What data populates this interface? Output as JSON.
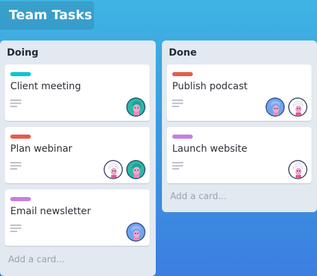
{
  "board": {
    "title": "Team Tasks"
  },
  "lists": [
    {
      "title": "Doing",
      "add_card": "Add a card...",
      "cards": [
        {
          "title": "Client meeting",
          "label_color": "#10c4d4",
          "avatars": [
            "teal-hair"
          ]
        },
        {
          "title": "Plan webinar",
          "label_color": "#e85c4a",
          "avatars": [
            "white-hair",
            "teal-hair"
          ]
        },
        {
          "title": "Email newsletter",
          "label_color": "#c57ee0",
          "avatars": [
            "blue-hair"
          ]
        }
      ]
    },
    {
      "title": "Done",
      "add_card": "Add a card...",
      "cards": [
        {
          "title": "Publish podcast",
          "label_color": "#e85c4a",
          "avatars": [
            "blue-hair",
            "white-hair"
          ]
        },
        {
          "title": "Launch website",
          "label_color": "#c57ee0",
          "avatars": [
            "white-hair"
          ]
        }
      ]
    }
  ],
  "colors": {
    "background_top": "#3fb4e2",
    "background_bottom": "#3d7ee0",
    "list_bg": "#e3e9f0"
  }
}
